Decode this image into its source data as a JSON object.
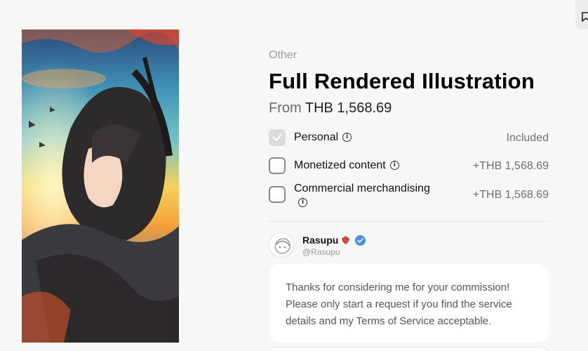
{
  "product": {
    "category": "Other",
    "title": "Full Rendered Illustration",
    "price_prefix": "From",
    "price": "THB 1,568.69"
  },
  "options": [
    {
      "label": "Personal",
      "price": "Included",
      "checked": true
    },
    {
      "label": "Monetized content",
      "price": "+THB 1,568.69",
      "checked": false
    },
    {
      "label": "Commercial merchandising",
      "price": "+THB 1,568.69",
      "checked": false
    }
  ],
  "artist": {
    "name": "Rasupu",
    "handle": "@Rasupu",
    "message": "Thanks for considering me for your commission! Please only start a request if you find the service details and my Terms of Service acceptable."
  },
  "colors": {
    "verified": "#4a90e2",
    "background": "#f7f7f7"
  },
  "icons": [
    "info-icon",
    "check-icon",
    "verified-icon",
    "strawberry-icon",
    "bookmark-icon"
  ]
}
